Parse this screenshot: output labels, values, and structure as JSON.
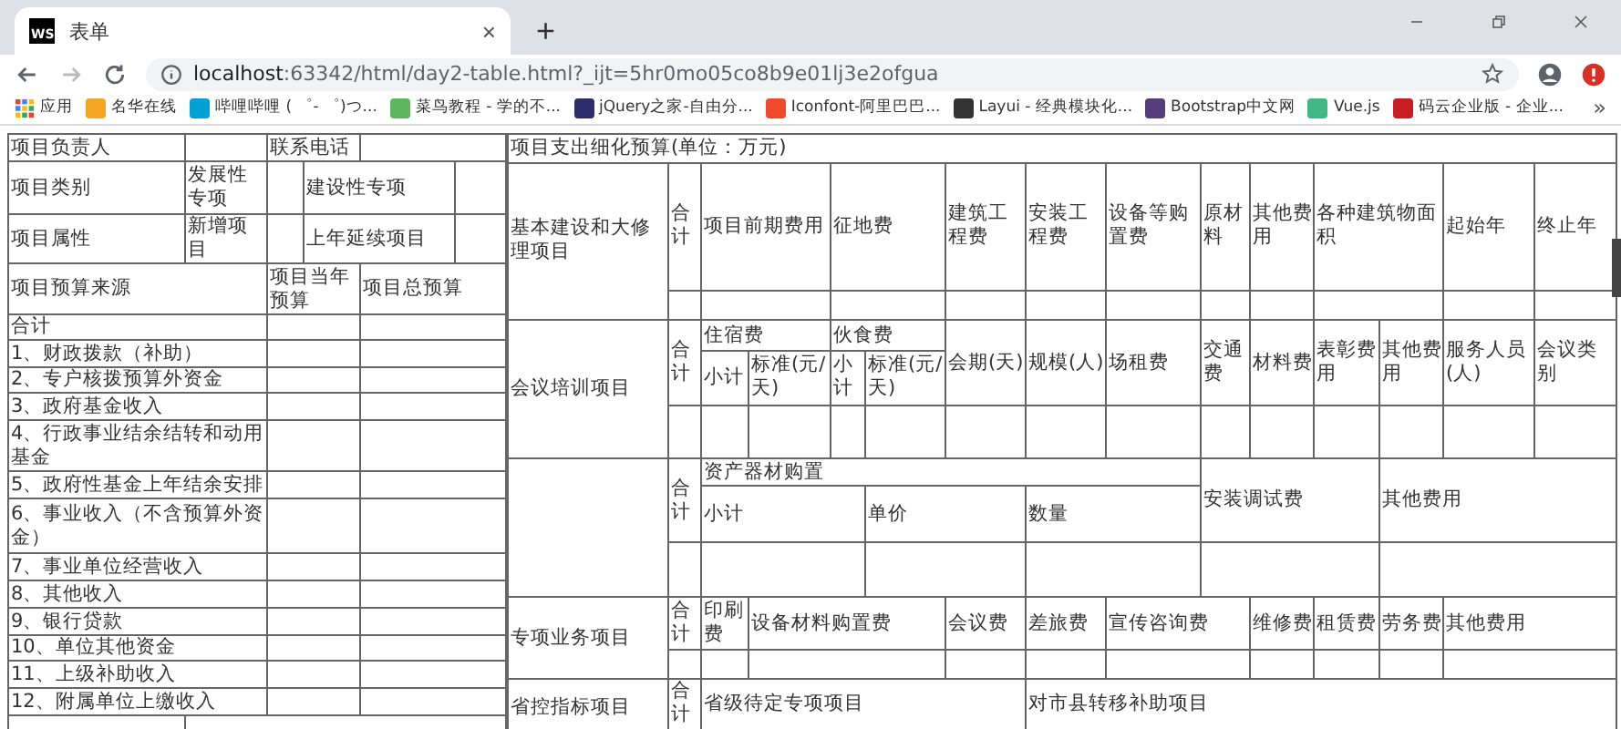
{
  "browser": {
    "tab": {
      "favicon_text": "WS",
      "title": "表单",
      "close": "×"
    },
    "new_tab": "+",
    "url": {
      "host": "localhost",
      "rest": ":63342/html/day2-table.html?_ijt=5hr0mo05co8b9e01lj3e2ofgua"
    },
    "bookmarks": [
      {
        "kind": "apps",
        "label": "应用"
      },
      {
        "kind": "site",
        "label": "名华在线",
        "color": "#f5a623"
      },
      {
        "kind": "site",
        "label": "哔哩哔哩 ( ゜- ゜)つ...",
        "color": "#00a1d6"
      },
      {
        "kind": "site",
        "label": "菜鸟教程 - 学的不...",
        "color": "#5cb85c"
      },
      {
        "kind": "site",
        "label": "jQuery之家-自由分...",
        "color": "#2d2d6e"
      },
      {
        "kind": "site",
        "label": "Iconfont-阿里巴巴...",
        "color": "#f04a2a"
      },
      {
        "kind": "site",
        "label": "Layui - 经典模块化...",
        "color": "#333333"
      },
      {
        "kind": "site",
        "label": "Bootstrap中文网",
        "color": "#563d7c"
      },
      {
        "kind": "site",
        "label": "Vue.js",
        "color": "#41b883"
      },
      {
        "kind": "site",
        "label": "码云企业版 - 企业...",
        "color": "#c71d23"
      }
    ],
    "bookmarks_more": "»"
  },
  "left_table": {
    "rows": [
      [
        {
          "text": "项目负责人"
        },
        {},
        {
          "text": "联系电话",
          "colspan": 2
        },
        {
          "colspan": 2
        }
      ],
      [
        {
          "text": "项目类别"
        },
        {
          "text": "发展性专项"
        },
        {},
        {
          "text": "建设性专项",
          "colspan": 2
        },
        {}
      ],
      [
        {
          "text": "项目属性"
        },
        {
          "text": "新增项目"
        },
        {},
        {
          "text": "上年延续项目",
          "colspan": 2
        },
        {}
      ],
      [
        {
          "text": "项目预算来源",
          "colspan": 2
        },
        {
          "text": "项目当年预算",
          "colspan": 2
        },
        {
          "text": "项目总预算",
          "colspan": 2
        }
      ],
      [
        {
          "text": "合计",
          "colspan": 2
        },
        {
          "colspan": 2
        },
        {
          "colspan": 2
        }
      ],
      [
        {
          "text": "1、财政拨款（补助）",
          "colspan": 2
        },
        {
          "colspan": 2
        },
        {
          "colspan": 2
        }
      ],
      [
        {
          "text": "2、专户核拨预算外资金",
          "colspan": 2
        },
        {
          "colspan": 2
        },
        {
          "colspan": 2
        }
      ],
      [
        {
          "text": "3、政府基金收入",
          "colspan": 2
        },
        {
          "colspan": 2
        },
        {
          "colspan": 2
        }
      ],
      [
        {
          "text": "4、行政事业结余结转和动用基金",
          "colspan": 2
        },
        {
          "colspan": 2
        },
        {
          "colspan": 2
        }
      ],
      [
        {
          "text": "5、政府性基金上年结余安排",
          "colspan": 2
        },
        {
          "colspan": 2
        },
        {
          "colspan": 2
        }
      ],
      [
        {
          "text": "6、事业收入（不含预算外资金）",
          "colspan": 2
        },
        {
          "colspan": 2
        },
        {
          "colspan": 2
        }
      ],
      [
        {
          "text": "7、事业单位经营收入",
          "colspan": 2
        },
        {
          "colspan": 2
        },
        {
          "colspan": 2
        }
      ],
      [
        {
          "text": "8、其他收入",
          "colspan": 2
        },
        {
          "colspan": 2
        },
        {
          "colspan": 2
        }
      ],
      [
        {
          "text": "9、银行贷款",
          "colspan": 2
        },
        {
          "colspan": 2
        },
        {
          "colspan": 2
        }
      ],
      [
        {
          "text": "10、单位其他资金",
          "colspan": 2
        },
        {
          "colspan": 2
        },
        {
          "colspan": 2
        }
      ],
      [
        {
          "text": "11、上级补助收入",
          "colspan": 2
        },
        {
          "colspan": 2
        },
        {
          "colspan": 2
        }
      ],
      [
        {
          "text": "12、附属单位上缴收入",
          "colspan": 2
        },
        {
          "colspan": 2
        },
        {
          "colspan": 2
        }
      ],
      [
        {},
        {
          "colspan": 5
        }
      ]
    ]
  },
  "right_table": {
    "rows": [
      [
        {
          "text": "项目支出细化预算(单位：万元)",
          "colspan": 15
        }
      ],
      [
        {
          "text": "基本建设和大修理项目",
          "rowspan": 2
        },
        {
          "text": "合计"
        },
        {
          "text": "项目前期费用",
          "colspan": 2
        },
        {
          "text": "征地费",
          "colspan": 2
        },
        {
          "text": "建筑工程费"
        },
        {
          "text": "安装工程费"
        },
        {
          "text": "设备等购置费"
        },
        {
          "text": "原材料"
        },
        {
          "text": "其他费用"
        },
        {
          "text": "各种建筑物面积",
          "colspan": 2
        },
        {
          "text": "起始年"
        },
        {
          "text": "终止年"
        }
      ],
      [
        {},
        {
          "colspan": 2
        },
        {
          "colspan": 2
        },
        {},
        {},
        {},
        {},
        {},
        {
          "colspan": 2
        },
        {},
        {}
      ],
      [
        {
          "text": "会议培训项目",
          "rowspan": 3
        },
        {
          "text": "合计",
          "rowspan": 2
        },
        {
          "text": "住宿费",
          "colspan": 2
        },
        {
          "text": "伙食费",
          "colspan": 2
        },
        {
          "text": "会期(天)",
          "rowspan": 2
        },
        {
          "text": "规模(人)",
          "rowspan": 2
        },
        {
          "text": "场租费",
          "rowspan": 2
        },
        {
          "text": "交通费",
          "rowspan": 2
        },
        {
          "text": "材料费",
          "rowspan": 2
        },
        {
          "text": "表彰费用",
          "rowspan": 2
        },
        {
          "text": "其他费用",
          "rowspan": 2
        },
        {
          "text": "服务人员(人)",
          "rowspan": 2
        },
        {
          "text": "会议类别",
          "rowspan": 2
        }
      ],
      [
        {
          "text": "小计"
        },
        {
          "text": "标准(元/天)"
        },
        {
          "text": "小计"
        },
        {
          "text": "标准(元/天)"
        }
      ],
      [
        {},
        {},
        {},
        {},
        {},
        {},
        {},
        {},
        {},
        {},
        {},
        {},
        {},
        {}
      ],
      [
        {
          "rowspan": 3
        },
        {
          "text": "合计",
          "rowspan": 2
        },
        {
          "text": "资产器材购置",
          "colspan": 7
        },
        {
          "text": "安装调试费",
          "colspan": 3,
          "rowspan": 2
        },
        {
          "text": "其他费用",
          "colspan": 3,
          "rowspan": 2
        }
      ],
      [
        {
          "text": "小计",
          "colspan": 3
        },
        {
          "text": "单价",
          "colspan": 2
        },
        {
          "text": "数量",
          "colspan": 2
        }
      ],
      [
        {},
        {
          "colspan": 3
        },
        {
          "colspan": 2
        },
        {
          "colspan": 2
        },
        {
          "colspan": 3
        },
        {
          "colspan": 3
        }
      ],
      [
        {
          "text": "专项业务项目",
          "rowspan": 2
        },
        {
          "text": "合计"
        },
        {
          "text": "印刷费"
        },
        {
          "text": "设备材料购置费",
          "colspan": 3
        },
        {
          "text": "会议费"
        },
        {
          "text": "差旅费"
        },
        {
          "text": "宣传咨询费",
          "colspan": 2
        },
        {
          "text": "维修费"
        },
        {
          "text": "租赁费"
        },
        {
          "text": "劳务费"
        },
        {
          "text": "其他费用",
          "colspan": 2
        }
      ],
      [
        {},
        {},
        {
          "colspan": 3
        },
        {},
        {},
        {
          "colspan": 2
        },
        {},
        {},
        {},
        {
          "colspan": 2
        }
      ],
      [
        {
          "text": "省控指标项目",
          "rowspan": 2
        },
        {
          "text": "合计"
        },
        {
          "text": "省级待定专项项目",
          "colspan": 5
        },
        {
          "text": "对市县转移补助项目",
          "colspan": 8
        }
      ],
      [
        {},
        {
          "colspan": 5
        },
        {
          "colspan": 8
        }
      ]
    ]
  }
}
